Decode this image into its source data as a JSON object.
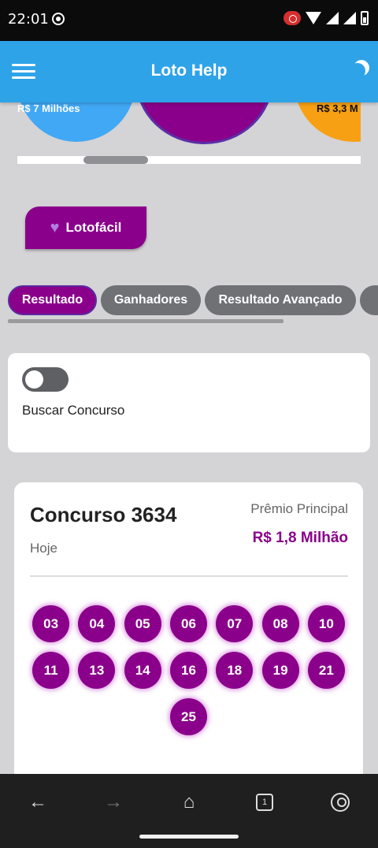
{
  "status_bar": {
    "time": "22:01"
  },
  "app_bar": {
    "title": "Loto Help"
  },
  "carousel": {
    "blue_label": "R$ 7 Milhões",
    "orange_label": "R$ 3,3 M"
  },
  "lottery": {
    "name": "Lotofácil",
    "color": "#8b008b"
  },
  "tabs": [
    {
      "label": "Resultado",
      "active": true
    },
    {
      "label": "Ganhadores"
    },
    {
      "label": "Resultado Avançado"
    },
    {
      "label": ""
    }
  ],
  "search": {
    "label": "Buscar Concurso",
    "enabled": false
  },
  "result": {
    "title": "Concurso 3634",
    "date": "Hoje",
    "prize_label": "Prêmio Principal",
    "prize_value": "R$ 1,8 Milhão",
    "numbers": [
      "03",
      "04",
      "05",
      "06",
      "07",
      "08",
      "10",
      "11",
      "13",
      "14",
      "16",
      "18",
      "19",
      "21",
      "25"
    ]
  },
  "bottom_nav": {
    "tabs_count": "1"
  },
  "colors": {
    "app_bar": "#2fa3e8",
    "accent": "#8b008b",
    "tab_inactive": "#6f7175"
  }
}
